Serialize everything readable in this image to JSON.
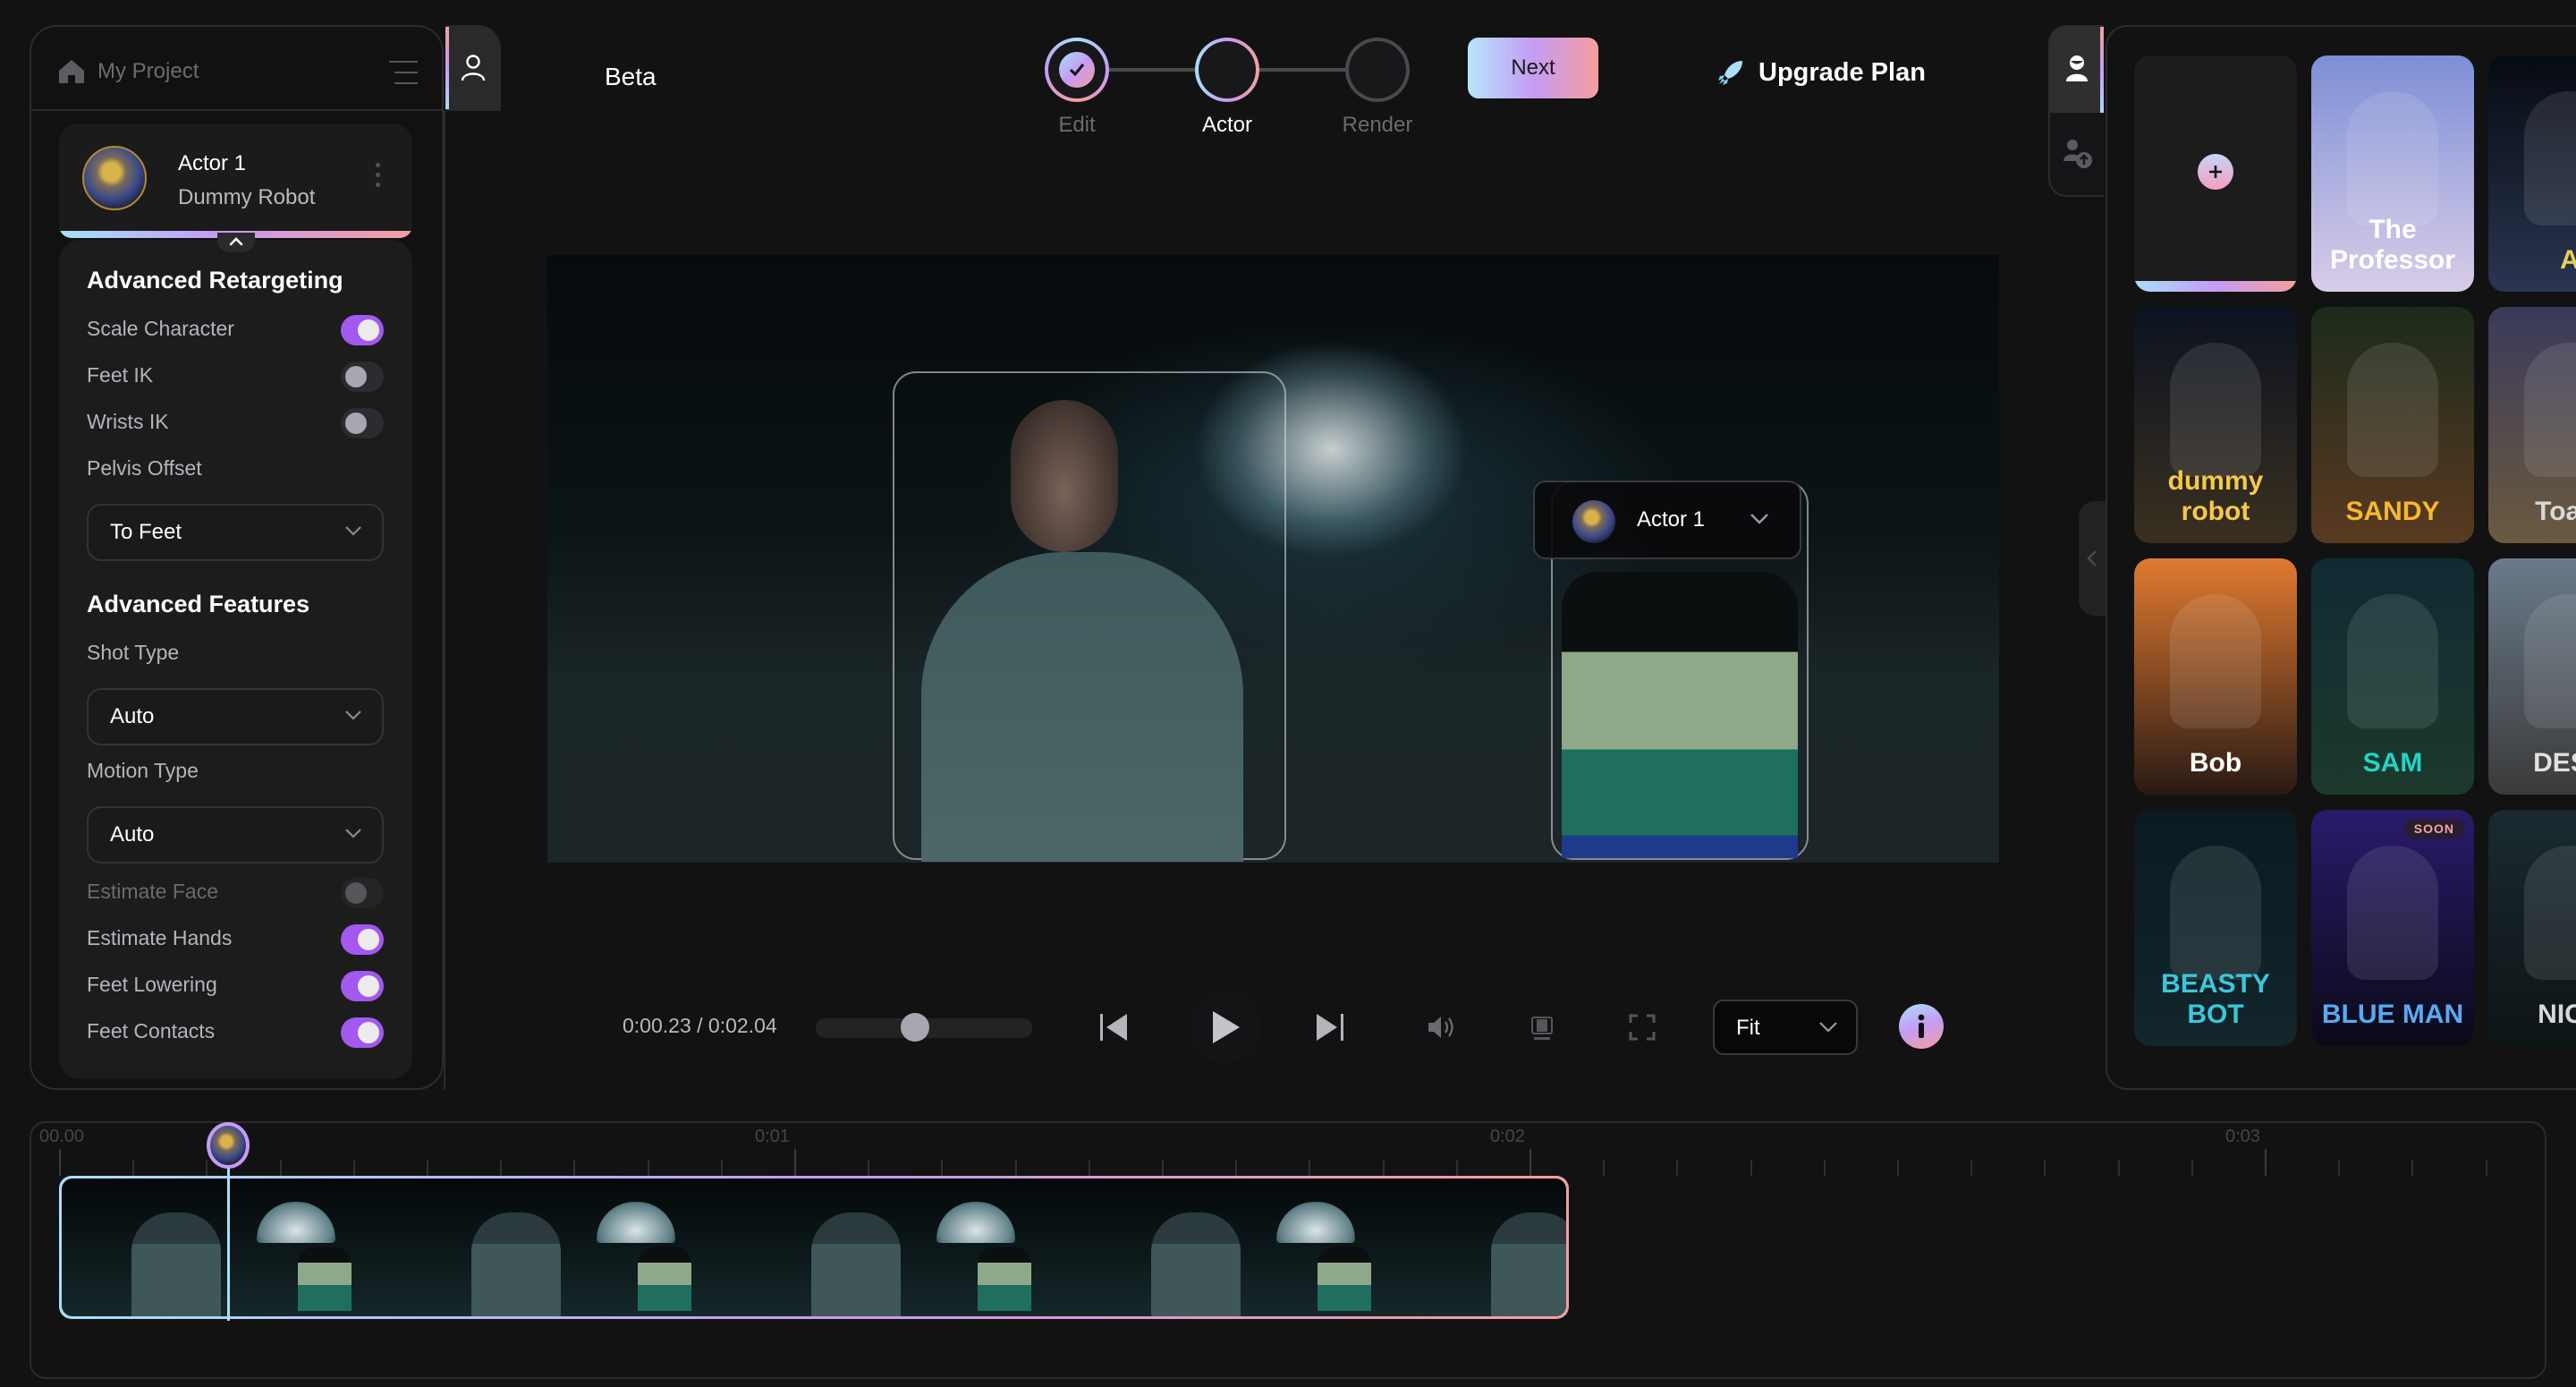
{
  "project": {
    "name": "My Project",
    "mode_label": "Beta"
  },
  "steps": [
    {
      "label": "Edit",
      "state": "done"
    },
    {
      "label": "Actor",
      "state": "current"
    },
    {
      "label": "Render",
      "state": "todo"
    }
  ],
  "header": {
    "next_label": "Next",
    "upgrade_label": "Upgrade Plan"
  },
  "actor_card": {
    "name": "Actor 1",
    "character": "Dummy Robot"
  },
  "settings": {
    "retargeting": {
      "title": "Advanced Retargeting",
      "toggles": [
        {
          "label": "Scale Character",
          "on": true,
          "disabled": false
        },
        {
          "label": "Feet IK",
          "on": false,
          "disabled": false
        },
        {
          "label": "Wrists IK",
          "on": false,
          "disabled": false
        }
      ],
      "pelvis_offset": {
        "label": "Pelvis Offset",
        "value": "To Feet"
      }
    },
    "features": {
      "title": "Advanced Features",
      "shot_type": {
        "label": "Shot Type",
        "value": "Auto"
      },
      "motion_type": {
        "label": "Motion Type",
        "value": "Auto"
      },
      "toggles": [
        {
          "label": "Estimate Face",
          "on": false,
          "disabled": true
        },
        {
          "label": "Estimate Hands",
          "on": true,
          "disabled": false
        },
        {
          "label": "Feet Lowering",
          "on": true,
          "disabled": false
        },
        {
          "label": "Feet Contacts",
          "on": true,
          "disabled": false
        }
      ]
    }
  },
  "video": {
    "overlay_actor": "Actor 1"
  },
  "player": {
    "time": "0:00.23 / 0:02.04",
    "scrub_progress": 0.45,
    "fit_value": "Fit"
  },
  "timeline": {
    "labels": [
      "00.00",
      "0:01",
      "0:02",
      "0:03"
    ],
    "playhead_seconds": 0.23
  },
  "gallery": {
    "cards": [
      {
        "title": "",
        "type": "add",
        "badge": ""
      },
      {
        "title": "The Professor",
        "type": "character",
        "badge": "",
        "colors": [
          "#7d8fd6",
          "#d9cde8"
        ],
        "text_color": "#ffffff"
      },
      {
        "title": "A",
        "type": "character",
        "badge": "",
        "colors": [
          "#060a12",
          "#2a3550"
        ],
        "text_color": "#e2d25a"
      },
      {
        "title": "dummy robot",
        "type": "character",
        "badge": "",
        "colors": [
          "#0b1220",
          "#3a3020"
        ],
        "text_color": "#f5c84a"
      },
      {
        "title": "SANDY",
        "type": "character",
        "badge": "",
        "colors": [
          "#1c2a1c",
          "#5a3a20"
        ],
        "text_color": "#f5b830"
      },
      {
        "title": "Toast",
        "type": "character",
        "badge": "",
        "colors": [
          "#3a3a5a",
          "#6a5a40"
        ],
        "text_color": "#d8d8d8"
      },
      {
        "title": "Bob",
        "type": "character",
        "badge": "",
        "colors": [
          "#e07a30",
          "#2a1a14"
        ],
        "text_color": "#ffffff"
      },
      {
        "title": "SAM",
        "type": "character",
        "badge": "",
        "colors": [
          "#0f2a33",
          "#1c3a2c"
        ],
        "text_color": "#22d3c5"
      },
      {
        "title": "DESE",
        "type": "character",
        "badge": "",
        "colors": [
          "#6a7a8a",
          "#3a3a3a"
        ],
        "text_color": "#e0e0e0"
      },
      {
        "title": "BEASTY BOT",
        "type": "character",
        "badge": "",
        "colors": [
          "#0a1a20",
          "#12262c"
        ],
        "text_color": "#3cc6d8"
      },
      {
        "title": "BLUE MAN",
        "type": "character",
        "badge": "SOON",
        "colors": [
          "#2a1a6a",
          "#0a0a18"
        ],
        "text_color": "#5aa8f0"
      },
      {
        "title": "NICE",
        "type": "character",
        "badge": "",
        "colors": [
          "#1a2a30",
          "#0e1416"
        ],
        "text_color": "#d8d8d8"
      }
    ]
  },
  "colors": {
    "accent_purple": "#a358f0",
    "gradient": [
      "#a7e0f8",
      "#c59bf4",
      "#f59e9e"
    ],
    "bg": "#121212"
  }
}
